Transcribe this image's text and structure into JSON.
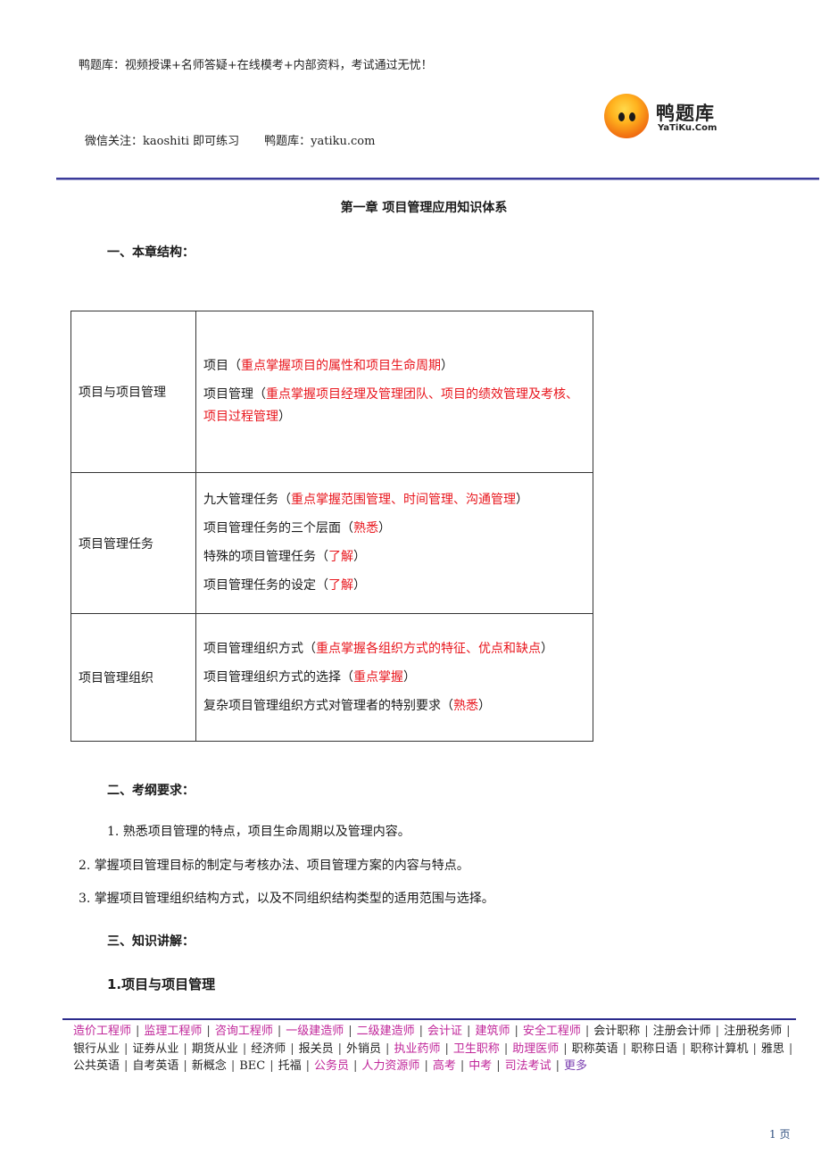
{
  "header": {
    "slogan": "鸭题库：视频授课+名师答疑+在线模考+内部资料，考试通过无忧！",
    "wechat": "微信关注：kaoshiti 即可练习",
    "site": "鸭题库：yatiku.com",
    "logo": {
      "icon": "duck-face-logo-icon",
      "name_cn": "鸭题库",
      "name_en": "YaTiKu.Com"
    }
  },
  "chapter_title": "第一章  项目管理应用知识体系",
  "sections": {
    "structure_heading": "一、本章结构：",
    "requirements_heading": "二、考纲要求：",
    "knowledge_heading": "三、知识讲解：",
    "subsection_heading": "1.项目与项目管理"
  },
  "structure_table": [
    {
      "category": "项目与项目管理",
      "items": [
        {
          "text": "项目（",
          "highlight": "重点掌握项目的属性和项目生命周期",
          "end": "）"
        },
        {
          "text": "项目管理（",
          "highlight": "重点掌握项目经理及管理团队、项目的绩效管理及考核、项目过程管理",
          "end": "）"
        }
      ]
    },
    {
      "category": "项目管理任务",
      "items": [
        {
          "text": "九大管理任务（",
          "highlight": "重点掌握范围管理、时间管理、沟通管理",
          "end": "）"
        },
        {
          "text": "项目管理任务的三个层面（",
          "highlight": "熟悉",
          "end": "）"
        },
        {
          "text": "特殊的项目管理任务（",
          "highlight": "了解",
          "end": "）"
        },
        {
          "text": "项目管理任务的设定（",
          "highlight": "了解",
          "end": "）"
        }
      ]
    },
    {
      "category": "项目管理组织",
      "items": [
        {
          "text": "项目管理组织方式（",
          "highlight": "重点掌握各组织方式的特征、优点和缺点",
          "end": "）"
        },
        {
          "text": "项目管理组织方式的选择（",
          "highlight": "重点掌握",
          "end": "）"
        },
        {
          "text": "复杂项目管理组织方式对管理者的特别要求（",
          "highlight": "熟悉",
          "end": "）"
        }
      ]
    }
  ],
  "requirements": [
    "1.  熟悉项目管理的特点，项目生命周期以及管理内容。",
    "2.  掌握项目管理目标的制定与考核办法、项目管理方案的内容与特点。",
    "3.  掌握项目管理组织结构方式，以及不同组织结构类型的适用范围与选择。"
  ],
  "footer": {
    "links": [
      {
        "label": "造价工程师",
        "color": "#c0269a"
      },
      {
        "label": "监理工程师",
        "color": "#c0269a"
      },
      {
        "label": "咨询工程师",
        "color": "#c0269a"
      },
      {
        "label": "一级建造师",
        "color": "#c0269a"
      },
      {
        "label": "二级建造师",
        "color": "#c0269a"
      },
      {
        "label": "会计证",
        "color": "#c0269a"
      },
      {
        "label": "建筑师",
        "color": "#c0269a"
      },
      {
        "label": "安全工程师",
        "color": "#c0269a"
      },
      {
        "label": "会计职称",
        "color": "#222222"
      },
      {
        "label": "注册会计师",
        "color": "#222222"
      },
      {
        "label": "注册税务师",
        "color": "#222222"
      },
      {
        "label": "银行从业",
        "color": "#222222"
      },
      {
        "label": "证券从业",
        "color": "#222222"
      },
      {
        "label": "期货从业",
        "color": "#222222"
      },
      {
        "label": "经济师",
        "color": "#222222"
      },
      {
        "label": "报关员",
        "color": "#222222"
      },
      {
        "label": "外销员",
        "color": "#222222"
      },
      {
        "label": "执业药师",
        "color": "#c0269a"
      },
      {
        "label": "卫生职称",
        "color": "#c0269a"
      },
      {
        "label": "助理医师",
        "color": "#c0269a"
      },
      {
        "label": "职称英语",
        "color": "#222222"
      },
      {
        "label": "职称日语",
        "color": "#222222"
      },
      {
        "label": "职称计算机",
        "color": "#222222"
      },
      {
        "label": "雅思",
        "color": "#222222"
      },
      {
        "label": "公共英语",
        "color": "#222222"
      },
      {
        "label": "自考英语",
        "color": "#222222"
      },
      {
        "label": "新概念",
        "color": "#222222"
      },
      {
        "label": "BEC",
        "color": "#222222"
      },
      {
        "label": "托福",
        "color": "#222222"
      },
      {
        "label": "公务员",
        "color": "#c0269a"
      },
      {
        "label": "人力资源师",
        "color": "#c0269a"
      },
      {
        "label": "高考",
        "color": "#c0269a"
      },
      {
        "label": "中考",
        "color": "#c0269a"
      },
      {
        "label": "司法考试",
        "color": "#c0269a"
      },
      {
        "label": "更多",
        "color": "#7b3fb0"
      }
    ],
    "separator": "|",
    "page_number": "1 页"
  }
}
